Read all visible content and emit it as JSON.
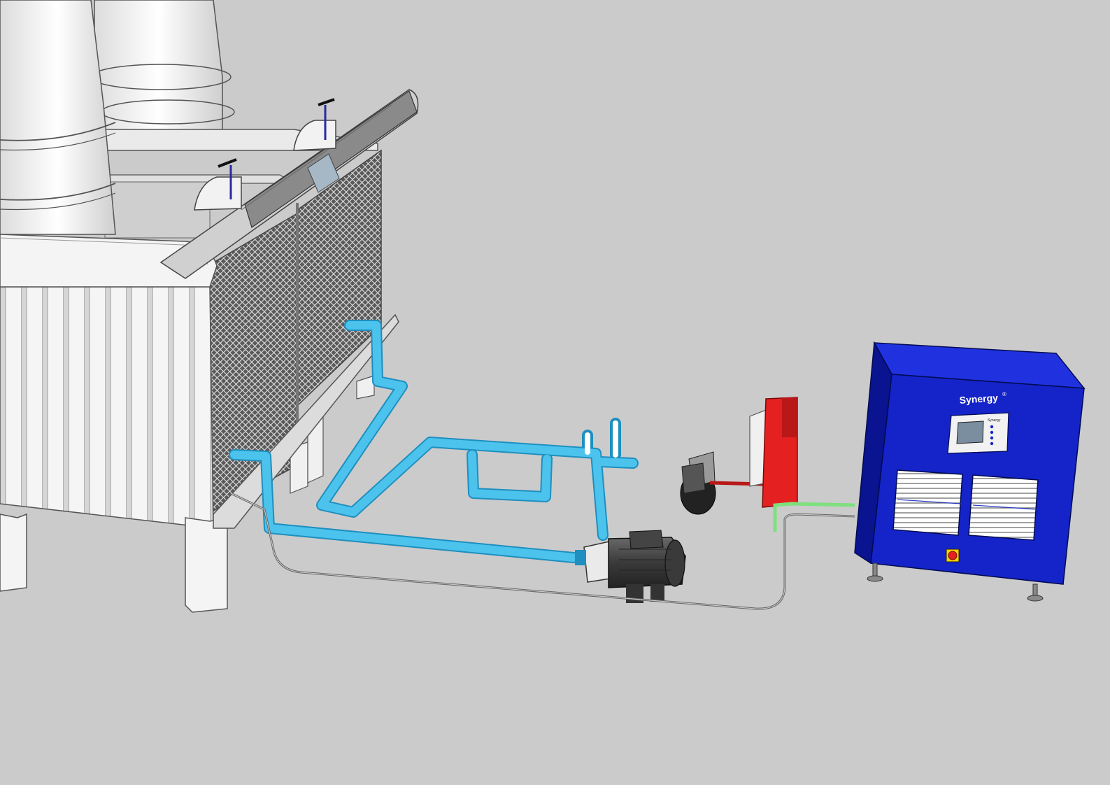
{
  "panel": {
    "brand": "Synergy",
    "brand_mark": "®",
    "brand_tagline": "",
    "hmi_brand": "Synergy"
  },
  "colors": {
    "background": "#cbcbcb",
    "tower_white": "#f2f2f2",
    "tower_shadow": "#bdbdbd",
    "water_pipe": "#4cc3ec",
    "water_pipe_dark": "#1e8fbf",
    "control_panel": "#1424c8",
    "control_panel_dark": "#0a1490",
    "ozone_generator": "#e52020",
    "ozone_line": "#b81818",
    "ground_wire": "#7ee07e",
    "motor": "#3a3a3a",
    "header_pipe": "#8a8a8a"
  },
  "components": [
    {
      "name": "cooling-tower",
      "icon": "cooling-tower-icon"
    },
    {
      "name": "fan-stacks",
      "icon": "fan-stack-icon"
    },
    {
      "name": "header-pipe",
      "icon": "pipe-icon"
    },
    {
      "name": "inlet-valves",
      "icon": "valve-icon"
    },
    {
      "name": "water-loop-piping",
      "icon": "pipe-icon"
    },
    {
      "name": "circulation-pump",
      "icon": "pump-motor-icon"
    },
    {
      "name": "air-compressor",
      "icon": "compressor-icon"
    },
    {
      "name": "ozone-generator",
      "icon": "ozone-generator-icon"
    },
    {
      "name": "control-panel",
      "icon": "control-cabinet-icon"
    },
    {
      "name": "emergency-stop",
      "icon": "e-stop-icon"
    }
  ]
}
